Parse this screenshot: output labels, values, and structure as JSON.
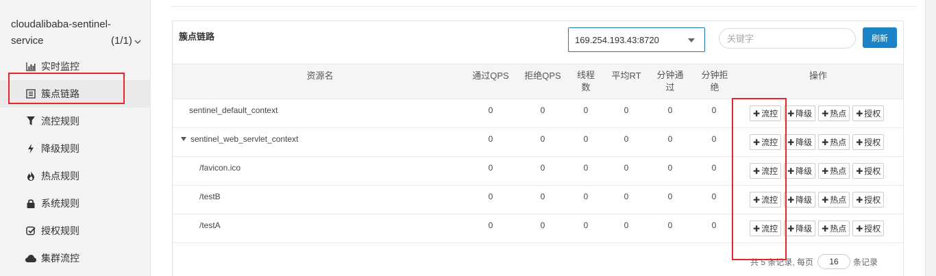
{
  "sidebar": {
    "app_name": "cloudalibaba-sentinel-service",
    "app_count": "(1/1)",
    "items": [
      {
        "label": "实时监控",
        "icon": "bar-chart-icon"
      },
      {
        "label": "簇点链路",
        "icon": "list-icon",
        "active": true
      },
      {
        "label": "流控规则",
        "icon": "filter-icon"
      },
      {
        "label": "降级规则",
        "icon": "flash-icon"
      },
      {
        "label": "热点规则",
        "icon": "fire-icon"
      },
      {
        "label": "系统规则",
        "icon": "lock-icon"
      },
      {
        "label": "授权规则",
        "icon": "check-square-icon"
      },
      {
        "label": "集群流控",
        "icon": "cloud-icon"
      }
    ]
  },
  "panel": {
    "title": "簇点链路",
    "machine": "169.254.193.43:8720",
    "search_placeholder": "关键字",
    "refresh_label": "刷新"
  },
  "table": {
    "headers": {
      "resource": "资源名",
      "pass_qps": "通过QPS",
      "block_qps": "拒绝QPS",
      "threads_1": "线程",
      "threads_2": "数",
      "avg_rt": "平均RT",
      "min_pass_1": "分钟通",
      "min_pass_2": "过",
      "min_block_1": "分钟拒",
      "min_block_2": "绝",
      "ops": "操作"
    },
    "rows": [
      {
        "resource": "sentinel_default_context",
        "pass_qps": "0",
        "block_qps": "0",
        "threads": "0",
        "avg_rt": "0",
        "min_pass": "0",
        "min_block": "0"
      },
      {
        "resource": "sentinel_web_servlet_context",
        "pass_qps": "0",
        "block_qps": "0",
        "threads": "0",
        "avg_rt": "0",
        "min_pass": "0",
        "min_block": "0"
      },
      {
        "resource": "/favicon.ico",
        "pass_qps": "0",
        "block_qps": "0",
        "threads": "0",
        "avg_rt": "0",
        "min_pass": "0",
        "min_block": "0"
      },
      {
        "resource": "/testB",
        "pass_qps": "0",
        "block_qps": "0",
        "threads": "0",
        "avg_rt": "0",
        "min_pass": "0",
        "min_block": "0"
      },
      {
        "resource": "/testA",
        "pass_qps": "0",
        "block_qps": "0",
        "threads": "0",
        "avg_rt": "0",
        "min_pass": "0",
        "min_block": "0"
      }
    ],
    "actions": {
      "flow": "流控",
      "degrade": "降级",
      "hotspot": "热点",
      "auth": "授权"
    }
  },
  "pagination": {
    "prefix": "共 5 条记录, 每页",
    "page_size": "16",
    "suffix": "条记录"
  },
  "colors": {
    "accent": "#1c84c6",
    "highlight": "#e8232a"
  }
}
